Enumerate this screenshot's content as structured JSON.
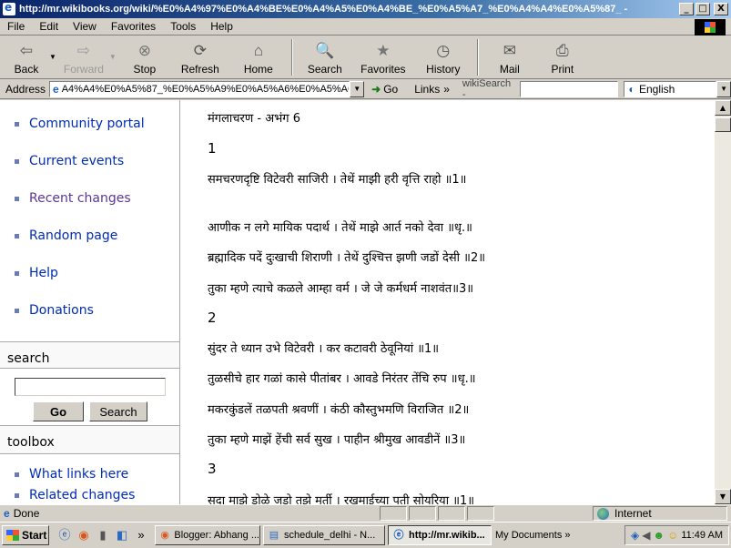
{
  "window": {
    "title": "http://mr.wikibooks.org/wiki/%E0%A4%97%E0%A4%BE%E0%A4%A5%E0%A4%BE_%E0%A5%A7_%E0%A4%A4%E0%A5%87_ -",
    "minimize": "_",
    "maximize": "□",
    "close": "X"
  },
  "menu": [
    "File",
    "Edit",
    "View",
    "Favorites",
    "Tools",
    "Help"
  ],
  "toolbar": {
    "back": "Back",
    "forward": "Forward",
    "stop": "Stop",
    "refresh": "Refresh",
    "home": "Home",
    "search": "Search",
    "favorites": "Favorites",
    "history": "History",
    "mail": "Mail",
    "print": "Print"
  },
  "address": {
    "label": "Address",
    "value": "A4%A4%E0%A5%87_%E0%A5%A9%E0%A5%A6%E0%A5%A6",
    "go": "Go",
    "links": "Links",
    "chev": "»",
    "wikisearch": "wikiSearch -",
    "language": "English"
  },
  "sidebar": {
    "nav": [
      "Community portal",
      "Current events",
      "Recent changes",
      "Random page",
      "Help",
      "Donations"
    ],
    "search_header": "search",
    "go_label": "Go",
    "search_label": "Search",
    "toolbox_header": "toolbox",
    "toolbox": [
      "What links here",
      "Related changes"
    ]
  },
  "article": {
    "title": "मंगलाचरण - अभंग 6",
    "sections": [
      {
        "num": "1",
        "lines": [
          "समचरणदृष्टि विटेवरी साजिरी । तेथें माझी हरी वृत्ति राहो ॥1॥",
          "आणीक न लगे मायिक पदार्थ । तेथें माझे आर्त नको देवा ॥धृ.॥",
          "ब्रह्मादिक पदें दुःखाची शिराणी । तेथें दुश्चित्त झणी जडों देसी ॥2॥",
          "तुका म्हणे त्याचे कळले आम्हा वर्म । जे जे कर्मधर्म नाशवंत॥3॥"
        ]
      },
      {
        "num": "2",
        "lines": [
          "सुंदर ते ध्यान उभे विटेवरी । कर कटावरी ठेवूनियां ॥1॥",
          "तुळसीचे हार गळां कासे पीतांबर । आवडे निरंतर तेंचि रुप ॥धृ.॥",
          "मकरकुंडलें तळपती श्रवणीं । कंठी कौस्तुभमणि विराजित ॥2॥",
          "तुका म्हणे माझें हेंची सर्व सुख । पाहीन श्रीमुख आवडीनें ॥3॥"
        ]
      },
      {
        "num": "3",
        "lines": [
          "सदा माझे डोळे जडो तुझे मूर्ती । रखुमाईच्या पती सोयरिया ॥1॥"
        ]
      }
    ]
  },
  "status": {
    "text": "Done",
    "zone": "Internet"
  },
  "taskbar": {
    "start": "Start",
    "chev": "»",
    "tasks": [
      "Blogger: Abhang ...",
      "schedule_delhi - N...",
      "http://mr.wikib..."
    ],
    "mydocs": "My Documents",
    "clock": "11:49 AM"
  }
}
